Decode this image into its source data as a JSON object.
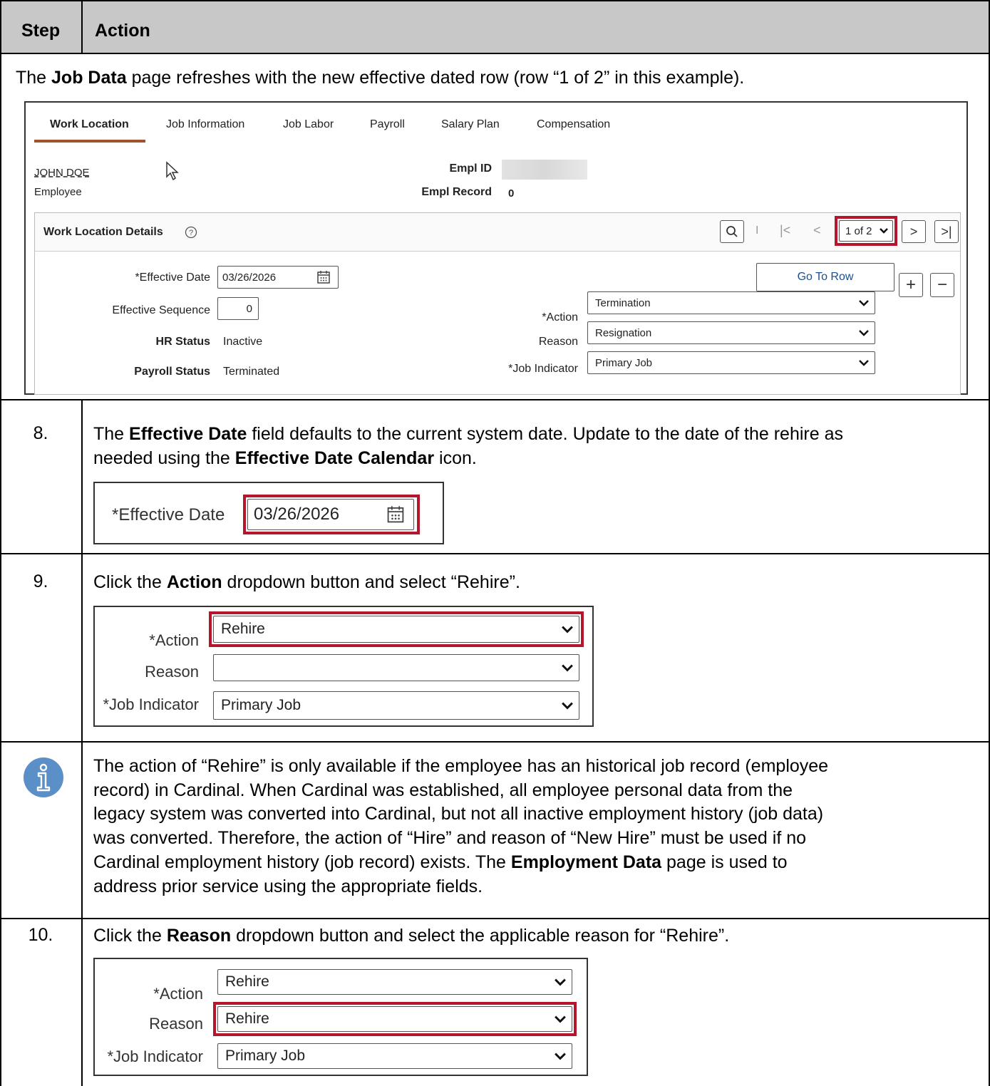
{
  "table": {
    "header_step": "Step",
    "header_action": "Action"
  },
  "intro": {
    "text_pre": "The ",
    "text_bold": "Job Data",
    "text_post": " page refreshes with the new effective dated row (row “1 of 2” in this example)."
  },
  "job_data": {
    "tabs": [
      "Work Location",
      "Job Information",
      "Job Labor",
      "Payroll",
      "Salary Plan",
      "Compensation"
    ],
    "employee_name": "JOHN DOE",
    "employee_type": "Employee",
    "empl_id_label": "Empl ID",
    "empl_record_label": "Empl Record",
    "empl_record_value": "0",
    "section_title": "Work Location Details",
    "row_counter": "1 of 2",
    "effective_date_label": "*Effective Date",
    "effective_date_value": "03/26/2026",
    "effective_seq_label": "Effective Sequence",
    "effective_seq_value": "0",
    "hr_status_label": "HR Status",
    "hr_status_value": "Inactive",
    "payroll_status_label": "Payroll Status",
    "payroll_status_value": "Terminated",
    "go_to_row": "Go To Row",
    "action_label": "*Action",
    "action_value": "Termination",
    "reason_label": "Reason",
    "reason_value": "Resignation",
    "job_indicator_label": "*Job Indicator",
    "job_indicator_value": "Primary Job"
  },
  "step8": {
    "number": "8.",
    "t1": "The ",
    "b1": "Effective Date",
    "t2": " field defaults to the current system date. Update to the date of the rehire as",
    "t3": "needed using the ",
    "b2": "Effective Date Calendar",
    "t4": " icon.",
    "label": "*Effective Date",
    "value": "03/26/2026"
  },
  "step9": {
    "number": "9.",
    "t1": "Click the ",
    "b1": "Action",
    "t2": " dropdown button and select “Rehire”.",
    "action_label": "*Action",
    "action_value": "Rehire",
    "reason_label": "Reason",
    "reason_value": "",
    "job_indicator_label": "*Job Indicator",
    "job_indicator_value": "Primary Job"
  },
  "note": {
    "line1": "The action of “Rehire” is only available if the employee has an historical job record (employee",
    "line2": "record) in Cardinal. When Cardinal was established, all employee personal data from the",
    "line3": "legacy system was converted into Cardinal, but not all inactive employment history (job data)",
    "line4": "was converted. Therefore, the action of “Hire” and reason of “New Hire” must be used if no",
    "line5_pre": "Cardinal employment history (job record) exists. The ",
    "line5_bold": "Employment Data",
    "line5_post": " page is used to",
    "line6": "address prior service using the appropriate fields."
  },
  "step10": {
    "number": "10.",
    "t1": "Click the ",
    "b1": "Reason",
    "t2": " dropdown button and select the applicable reason for “Rehire”.",
    "action_label": "*Action",
    "action_value": "Rehire",
    "reason_label": "Reason",
    "reason_value": "Rehire",
    "job_indicator_label": "*Job Indicator",
    "job_indicator_value": "Primary Job"
  },
  "colors": {
    "header_bg": "#c8c8c8",
    "highlight_red": "#b5162b",
    "info_blue": "#5b8fc7",
    "tab_underline": "#a0522d"
  },
  "icons": [
    "cursor-arrow-icon",
    "help-circle-icon",
    "search-icon",
    "first-icon",
    "prev-icon",
    "next-icon",
    "last-icon",
    "calendar-icon",
    "plus-icon",
    "minus-icon",
    "chevron-down-icon",
    "info-icon"
  ]
}
